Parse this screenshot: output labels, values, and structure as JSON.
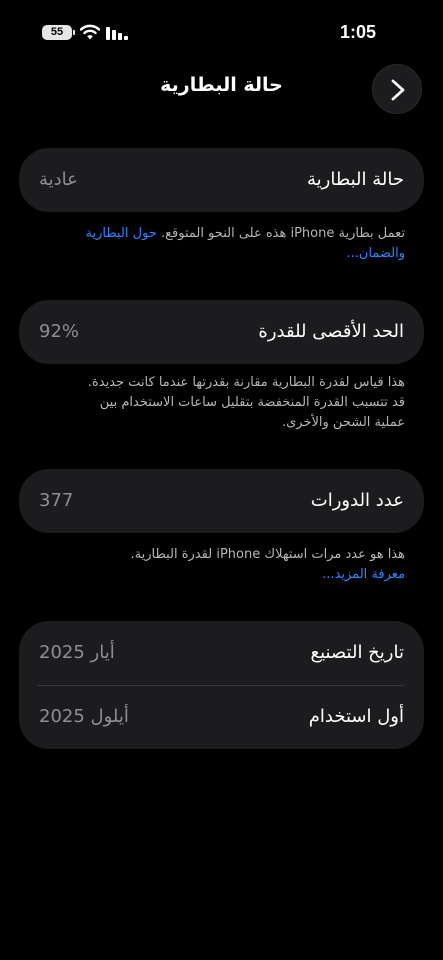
{
  "status_bar": {
    "battery_level": "55",
    "time": "1:05"
  },
  "header": {
    "title": "حالة البطارية"
  },
  "battery_health": {
    "label": "حالة البطارية",
    "value": "عادية",
    "footnote": "تعمل بطارية iPhone هذه على النحو المتوقع.",
    "link": "حول البطارية والضمان..."
  },
  "maximum_capacity": {
    "label": "الحد الأقصى للقدرة",
    "value": "92%",
    "footnote_lines": [
      "هذا قياس لقدرة البطارية مقارنة بقدرتها عندما كانت جديدة.",
      "قد تتسبب القدرة المنخفضة بتقليل ساعات الاستخدام بين",
      "عملية الشحن والأخرى."
    ]
  },
  "cycle_count": {
    "label": "عدد الدورات",
    "value": "377",
    "footnote": "هذا هو عدد مرات استهلاك iPhone لقدرة البطارية.",
    "link": "معرفة المزيد..."
  },
  "dates": {
    "manufacture_label": "تاريخ التصنيع",
    "manufacture_value": "أيار 2025",
    "first_use_label": "أول استخدام",
    "first_use_value": "أيلول 2025"
  },
  "colors": {
    "background": "#000000",
    "card": "#1c1c1e",
    "link": "#2d86ff",
    "secondary_text": "#8e8e93"
  }
}
